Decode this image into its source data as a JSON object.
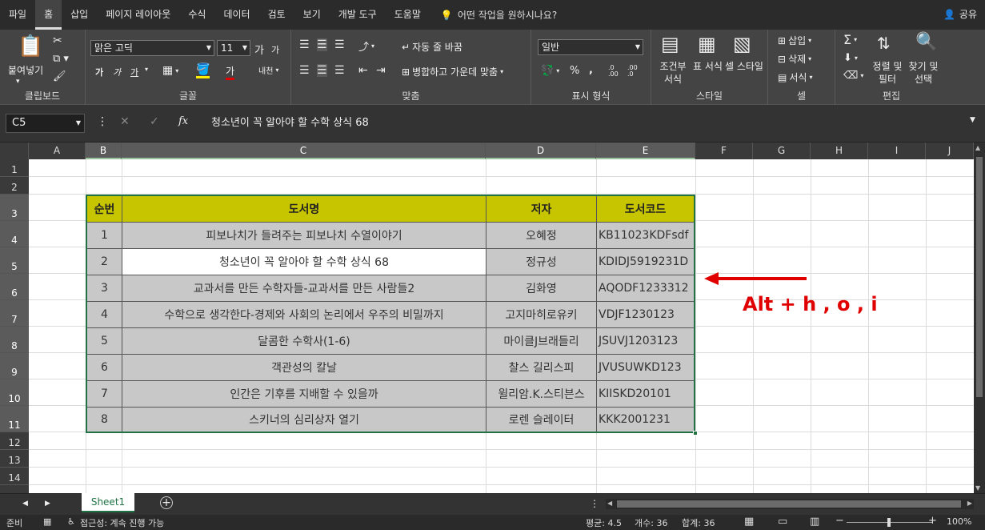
{
  "menu": {
    "tabs": [
      "파일",
      "홈",
      "삽입",
      "페이지 레이아웃",
      "수식",
      "데이터",
      "검토",
      "보기",
      "개발 도구",
      "도움말"
    ],
    "help": "어떤 작업을 원하시나요?",
    "share": "공유"
  },
  "ribbon": {
    "clipboard": {
      "paste": "붙여넣기",
      "label": "클립보드"
    },
    "font": {
      "name": "맑은 고딕",
      "size": "11",
      "grow": "가",
      "shrink": "가",
      "bold": "가",
      "italic": "가",
      "underline": "가",
      "label": "글꼴",
      "font_color": "가",
      "phonetic": "내천"
    },
    "align": {
      "wrap": "자동 줄 바꿈",
      "merge": "병합하고 가운데 맞춤",
      "label": "맞춤"
    },
    "number": {
      "format": "일반",
      "percent": "%",
      "comma": ",",
      "inc": ".0 .00",
      "dec": ".00 .0",
      "label": "표시 형식"
    },
    "styles": {
      "cond": "조건부 서식",
      "table": "표 서식",
      "cell": "셀 스타일",
      "label": "스타일"
    },
    "cells": {
      "insert": "삽입",
      "delete": "삭제",
      "format": "서식",
      "label": "셀"
    },
    "editing": {
      "sort": "정렬 및 필터",
      "find": "찾기 및 선택",
      "label": "편집"
    }
  },
  "formula_bar": {
    "name_box": "C5",
    "formula": "청소년이 꼭 알아야 할 수학 상식 68",
    "fx": "fx"
  },
  "columns": [
    "A",
    "B",
    "C",
    "D",
    "E",
    "F",
    "G",
    "H",
    "I",
    "J"
  ],
  "rows": [
    "1",
    "2",
    "3",
    "4",
    "5",
    "6",
    "7",
    "8",
    "9",
    "10",
    "11",
    "12",
    "13",
    "14"
  ],
  "table": {
    "headers": [
      "순번",
      "도서명",
      "저자",
      "도서코드"
    ],
    "rows": [
      [
        "1",
        "피보나치가 들려주는 피보나치 수열이야기",
        "오혜정",
        "KB11023KDFsdf"
      ],
      [
        "2",
        "청소년이 꼭 알아야 할 수학 상식 68",
        "정규성",
        "KDIDJ5919231D"
      ],
      [
        "3",
        "교과서를 만든 수학자들-교과서를 만든 사람들2",
        "김화영",
        "AQODF1233312"
      ],
      [
        "4",
        "수학으로 생각한다-경제와 사회의 논리에서 우주의 비밀까지",
        "고지마히로유키",
        "VDJF1230123"
      ],
      [
        "5",
        "달콤한 수학사(1-6)",
        "마이클J브래들리",
        "JSUVJ1203123"
      ],
      [
        "6",
        "객관성의 칼날",
        "찰스 길리스피",
        "JVUSUWKD123"
      ],
      [
        "7",
        "인간은 기후를 지배할 수 있을까",
        "윌리암.K.스티븐스",
        "KIISKD20101"
      ],
      [
        "8",
        "스키너의 심리상자 열기",
        "로렌 슬레이터",
        "KKK2001231"
      ]
    ]
  },
  "annotation": "Alt + h , o , i",
  "sheet": {
    "name": "Sheet1",
    "add": "+"
  },
  "status": {
    "ready": "준비",
    "accessibility": "접근성: 계속 진행 가능",
    "average": "평균: 4.5",
    "count": "개수: 36",
    "sum": "합계: 36",
    "zoom": "100%"
  }
}
